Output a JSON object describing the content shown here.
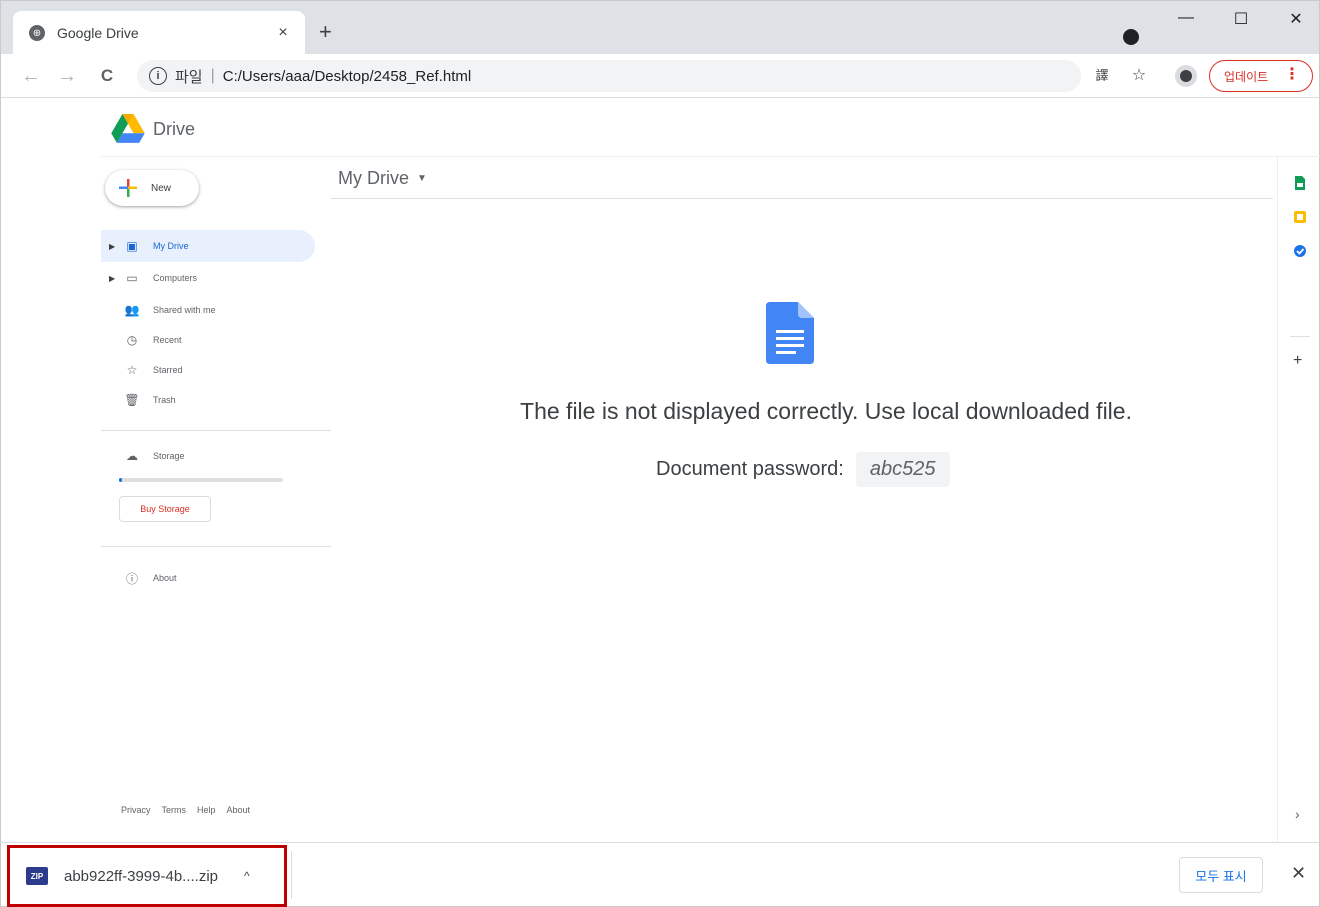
{
  "browser": {
    "tab_title": "Google Drive",
    "tab_close": "×",
    "new_tab": "+",
    "minimize": "—",
    "maximize": "☐",
    "close": "✕",
    "back": "←",
    "forward": "→",
    "reload": "C",
    "address_scheme": "파일",
    "address_url": "C:/Users/aaa/Desktop/2458_Ref.html",
    "update_label": "업데이트",
    "update_menu": "⋮",
    "translate_icon": "translate-icon",
    "bookmark_icon": "star-icon"
  },
  "drive": {
    "logo_text": "Drive",
    "new_label": "New",
    "nav": [
      {
        "label": "My Drive",
        "icon": "my-drive-icon",
        "active": true,
        "expand": true
      },
      {
        "label": "Computers",
        "icon": "computers-icon",
        "active": false,
        "expand": true
      },
      {
        "label": "Shared with me",
        "icon": "shared-icon",
        "active": false,
        "expand": false
      },
      {
        "label": "Recent",
        "icon": "clock-icon",
        "active": false,
        "expand": false
      },
      {
        "label": "Starred",
        "icon": "star-icon",
        "active": false,
        "expand": false
      },
      {
        "label": "Trash",
        "icon": "trash-icon",
        "active": false,
        "expand": false
      }
    ],
    "storage_label": "Storage",
    "storage_fraction": 0.02,
    "buy_storage": "Buy Storage",
    "about_label": "About",
    "footer": [
      "Privacy",
      "Terms",
      "Help",
      "About"
    ],
    "breadcrumb": "My Drive",
    "message": "The file is not displayed correctly. Use local downloaded file.",
    "password_label": "Document password:",
    "password_value": "abc525",
    "side_panel_plus": "+",
    "side_panel_chevron": "›"
  },
  "downloads": {
    "file_name": "abb922ff-3999-4b....zip",
    "file_icon": "zip-icon",
    "file_icon_text": "ZIP",
    "expand": "^",
    "show_all": "모두 표시",
    "close": "✕"
  },
  "colors": {
    "accent_blue": "#1a73e8",
    "update_red": "#d93025",
    "highlight_red": "#c00000"
  }
}
